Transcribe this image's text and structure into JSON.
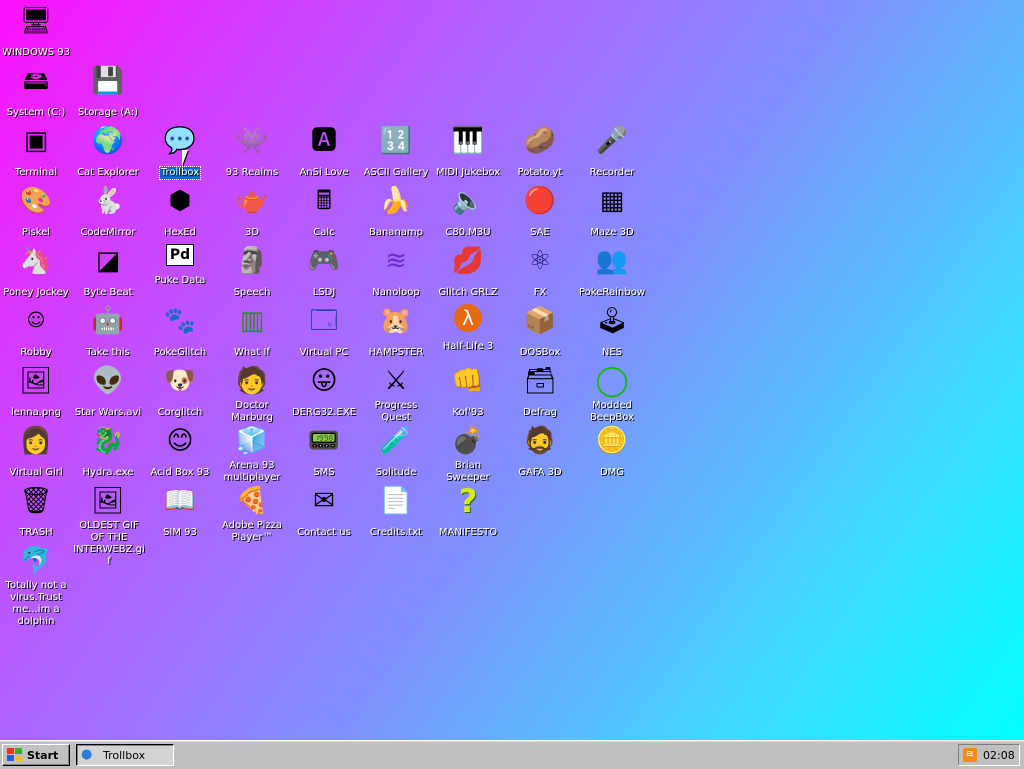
{
  "desktop": {
    "icons": [
      {
        "label": "WINDOWS 93",
        "glyph": "🖥"
      },
      {
        "label": "System (C:)",
        "glyph": "🖴"
      },
      {
        "label": "Storage (A:)",
        "glyph": "💾"
      },
      {
        "label": "Terminal",
        "glyph": "▣"
      },
      {
        "label": "Cat Explorer",
        "glyph": "🌍"
      },
      {
        "label": "Trollbox",
        "glyph": "💬"
      },
      {
        "label": "93 Realms",
        "glyph": "👾"
      },
      {
        "label": "AnSi Love",
        "glyph": "🅰"
      },
      {
        "label": "ASCII Gallery",
        "glyph": "🔢"
      },
      {
        "label": "MIDI Jukebox",
        "glyph": "🎹"
      },
      {
        "label": "Potato.yt",
        "glyph": "🥔"
      },
      {
        "label": "Recorder",
        "glyph": "🎤"
      },
      {
        "label": "Piskel",
        "glyph": "🎨"
      },
      {
        "label": "CodeMirror",
        "glyph": "🐇"
      },
      {
        "label": "HexEd",
        "glyph": "⬢"
      },
      {
        "label": "3D",
        "glyph": "🫖"
      },
      {
        "label": "Calc",
        "glyph": "🖩"
      },
      {
        "label": "Bananamp",
        "glyph": "🍌"
      },
      {
        "label": "C80.M3U",
        "glyph": "🔈"
      },
      {
        "label": "SAE",
        "glyph": "🔴"
      },
      {
        "label": "Maze 3D",
        "glyph": "▦"
      },
      {
        "label": "Poney Jockey",
        "glyph": "🦄"
      },
      {
        "label": "Byte Beat",
        "glyph": "◪"
      },
      {
        "label": "Puke Data",
        "glyph": "Pd"
      },
      {
        "label": "Speech",
        "glyph": "🗿"
      },
      {
        "label": "LSDJ",
        "glyph": "🎮"
      },
      {
        "label": "Nanoloop",
        "glyph": "≋"
      },
      {
        "label": "Glitch GRLZ",
        "glyph": "💋"
      },
      {
        "label": "FX",
        "glyph": "⚛"
      },
      {
        "label": "PokeRainbow",
        "glyph": "👥"
      },
      {
        "label": "Robby",
        "glyph": "☺"
      },
      {
        "label": "Take this",
        "glyph": "🤖"
      },
      {
        "label": "PokeGlitch",
        "glyph": "🐾"
      },
      {
        "label": "What If",
        "glyph": "▥"
      },
      {
        "label": "Virtual PC",
        "glyph": "🗔"
      },
      {
        "label": "HAMPSTER",
        "glyph": "🐹"
      },
      {
        "label": "Half-Life 3",
        "glyph": "λ"
      },
      {
        "label": "DOSBox",
        "glyph": "📦"
      },
      {
        "label": "NES",
        "glyph": "🕹"
      },
      {
        "label": "lenna.png",
        "glyph": "🖼"
      },
      {
        "label": "Star Wars.avi",
        "glyph": "👽"
      },
      {
        "label": "Corglitch",
        "glyph": "🐶"
      },
      {
        "label": "Doctor Marburg",
        "glyph": "🧑"
      },
      {
        "label": "DERG32.EXE",
        "glyph": "😛"
      },
      {
        "label": "Progress Quest",
        "glyph": "⚔"
      },
      {
        "label": "Kof'93",
        "glyph": "👊"
      },
      {
        "label": "Defrag",
        "glyph": "🗃"
      },
      {
        "label": "Modded BeepBox",
        "glyph": "◯"
      },
      {
        "label": "Virtual Girl",
        "glyph": "👩"
      },
      {
        "label": "Hydra.exe",
        "glyph": "🐉"
      },
      {
        "label": "Acid Box 93",
        "glyph": "😊"
      },
      {
        "label": "Arena 93 multiplayer",
        "glyph": "🧊"
      },
      {
        "label": "SMS",
        "glyph": "📟"
      },
      {
        "label": "Solitude",
        "glyph": "🧪"
      },
      {
        "label": "Brian Sweeper",
        "glyph": "💣"
      },
      {
        "label": "GAFA 3D",
        "glyph": "🧔"
      },
      {
        "label": "DMG",
        "glyph": "🪙"
      },
      {
        "label": "TRASH",
        "glyph": "🗑"
      },
      {
        "label": "OLDEST GIF OF THE INTERWEBZ.gif",
        "glyph": "🖼"
      },
      {
        "label": "SIM 93",
        "glyph": "📖"
      },
      {
        "label": "Adobe Pizza Player™",
        "glyph": "🍕"
      },
      {
        "label": "Contact us",
        "glyph": "✉"
      },
      {
        "label": "Credits.txt",
        "glyph": "📄"
      },
      {
        "label": "MANIFESTO",
        "glyph": "?"
      },
      {
        "label": "Totally not a virus.Trust me...im a dolphin",
        "glyph": "🐬"
      }
    ]
  },
  "taskbar": {
    "start_label": "Start",
    "tasks": [
      {
        "label": "Trollbox"
      }
    ],
    "tray": {
      "clock": "02:08",
      "icon": "rss-icon"
    }
  },
  "colors": {
    "selection": "#0a6cc4",
    "taskbar": "#c0c0c0",
    "gradient_start": "#ff10ff",
    "gradient_end": "#00ffff"
  }
}
